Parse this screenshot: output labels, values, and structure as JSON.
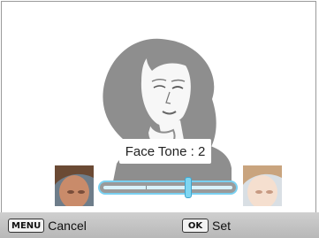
{
  "label": {
    "text": "Face Tone : 2"
  },
  "slider": {
    "value": 2,
    "min": 0,
    "max": 3
  },
  "buttons": {
    "cancel": {
      "key": "MENU",
      "label": "Cancel"
    },
    "set": {
      "key": "OK",
      "label": "Set"
    }
  },
  "colors": {
    "slider_accent": "#7ad0f0",
    "bottom_bar": "#c4c4c4"
  }
}
